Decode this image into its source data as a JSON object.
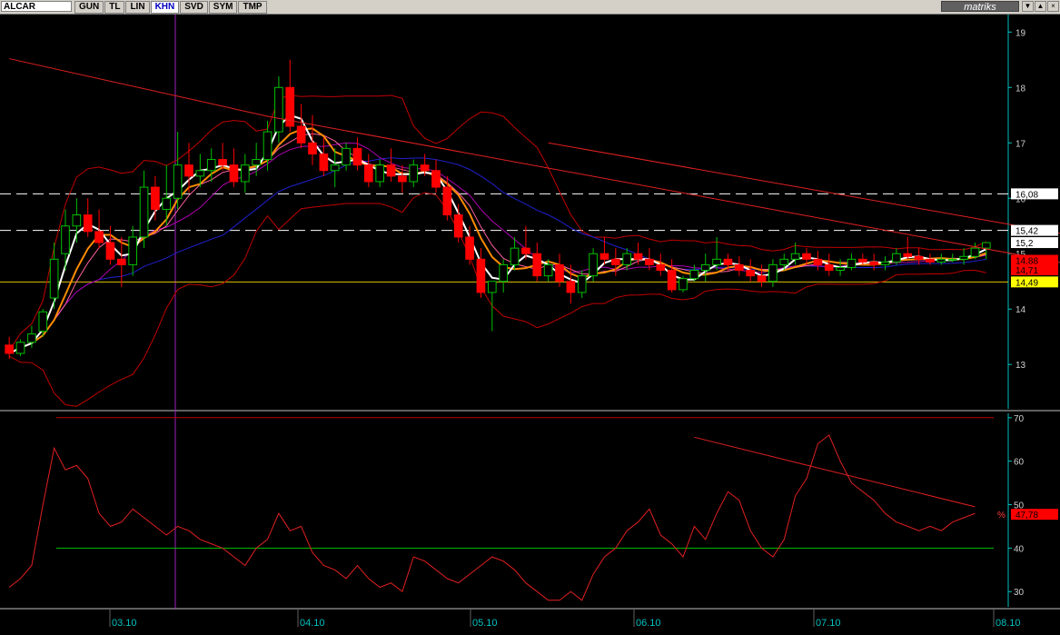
{
  "toolbar": {
    "symbol": "ALCAR",
    "tabs": [
      "GUN",
      "TL",
      "LIN",
      "KHN",
      "SVD",
      "SYM",
      "TMP"
    ],
    "active_tab": "KHN",
    "logo": "matriks",
    "buttons": [
      "▼",
      "▲",
      "×"
    ]
  },
  "x_axis": {
    "labels": [
      "03.10",
      "04.10",
      "05.10",
      "06.10",
      "07.10",
      "08.10"
    ]
  },
  "colors": {
    "up": "#00c000",
    "down": "#ff0000",
    "bollinger": "#c00000",
    "rsi": "#e02020",
    "ma_white": "#ffffff",
    "ma_orange": "#ff8c00",
    "ma_blue": "#2020d0",
    "ma_purple": "#b000b0",
    "ma_pink": "#ff60a0",
    "axis": "#00c0c0"
  },
  "chart_data": [
    {
      "type": "candlestick",
      "ylim": [
        12.2,
        19.3
      ],
      "yticks": [
        13,
        14,
        15,
        16,
        17,
        18,
        19
      ],
      "price_labels": [
        {
          "value": 16.08,
          "text": "16,08",
          "bg": "#ffffff",
          "fg": "#000000"
        },
        {
          "value": 15.42,
          "text": "15,42",
          "bg": "#ffffff",
          "fg": "#000000"
        },
        {
          "value": 15.2,
          "text": "15,2",
          "bg": "#ffffff",
          "fg": "#000000"
        },
        {
          "value": 14.88,
          "text": "14,88",
          "bg": "#ff0000",
          "fg": "#000000"
        },
        {
          "value": 14.71,
          "text": "14,71",
          "bg": "#ff0000",
          "fg": "#000000"
        },
        {
          "value": 14.49,
          "text": "14,49",
          "bg": "#ffff00",
          "fg": "#000000"
        }
      ],
      "horizontal_lines": [
        {
          "value": 16.08,
          "style": "dashed"
        },
        {
          "value": 15.42,
          "style": "dashed"
        },
        {
          "value": 14.49,
          "style": "solid-yellow"
        }
      ],
      "trendlines": [
        [
          {
            "i": 0,
            "v": 18.52
          },
          {
            "i": 23,
            "v": 17.48
          }
        ],
        [
          {
            "i": 23,
            "v": 17.48
          },
          {
            "i": 96,
            "v": 14.75
          }
        ],
        [
          {
            "i": 48,
            "v": 17.0
          },
          {
            "i": 96,
            "v": 15.28
          }
        ]
      ],
      "ohlc": [
        [
          13.35,
          13.5,
          13.1,
          13.2
        ],
        [
          13.2,
          13.45,
          13.15,
          13.4
        ],
        [
          13.4,
          13.7,
          13.3,
          13.55
        ],
        [
          13.6,
          14.0,
          13.5,
          13.95
        ],
        [
          14.2,
          15.2,
          14.0,
          14.9
        ],
        [
          15.0,
          15.8,
          14.7,
          15.5
        ],
        [
          15.5,
          16.0,
          15.2,
          15.7
        ],
        [
          15.7,
          16.0,
          15.3,
          15.4
        ],
        [
          15.4,
          15.8,
          15.1,
          15.2
        ],
        [
          15.2,
          15.5,
          14.8,
          14.9
        ],
        [
          14.9,
          15.3,
          14.4,
          14.8
        ],
        [
          14.8,
          15.5,
          14.6,
          15.3
        ],
        [
          15.3,
          16.5,
          15.1,
          16.2
        ],
        [
          16.2,
          16.4,
          15.6,
          15.8
        ],
        [
          15.8,
          16.6,
          15.5,
          16.0
        ],
        [
          16.0,
          17.2,
          15.8,
          16.6
        ],
        [
          16.6,
          17.0,
          16.1,
          16.4
        ],
        [
          16.4,
          16.8,
          16.2,
          16.5
        ],
        [
          16.5,
          16.9,
          16.3,
          16.7
        ],
        [
          16.7,
          17.0,
          16.5,
          16.6
        ],
        [
          16.6,
          16.9,
          16.2,
          16.3
        ],
        [
          16.3,
          16.8,
          16.1,
          16.6
        ],
        [
          16.6,
          17.0,
          16.4,
          16.7
        ],
        [
          16.7,
          17.4,
          16.5,
          17.2
        ],
        [
          17.2,
          18.2,
          17.0,
          18.0
        ],
        [
          18.0,
          18.5,
          17.2,
          17.3
        ],
        [
          17.3,
          17.7,
          16.9,
          17.0
        ],
        [
          17.0,
          17.5,
          16.6,
          16.8
        ],
        [
          16.8,
          17.1,
          16.4,
          16.5
        ],
        [
          16.5,
          16.9,
          16.2,
          16.6
        ],
        [
          16.6,
          17.0,
          16.5,
          16.9
        ],
        [
          16.9,
          17.1,
          16.5,
          16.6
        ],
        [
          16.6,
          16.8,
          16.2,
          16.3
        ],
        [
          16.3,
          16.7,
          16.2,
          16.6
        ],
        [
          16.6,
          16.9,
          16.3,
          16.4
        ],
        [
          16.4,
          16.6,
          16.1,
          16.3
        ],
        [
          16.3,
          16.7,
          16.2,
          16.6
        ],
        [
          16.6,
          16.8,
          16.4,
          16.5
        ],
        [
          16.5,
          16.7,
          16.1,
          16.2
        ],
        [
          16.2,
          16.4,
          15.6,
          15.7
        ],
        [
          15.7,
          15.9,
          15.2,
          15.3
        ],
        [
          15.3,
          15.5,
          14.8,
          14.9
        ],
        [
          14.9,
          15.1,
          14.2,
          14.3
        ],
        [
          14.3,
          14.5,
          13.6,
          14.5
        ],
        [
          14.5,
          14.9,
          14.3,
          14.8
        ],
        [
          14.8,
          15.3,
          14.7,
          15.1
        ],
        [
          15.1,
          15.5,
          14.9,
          15.0
        ],
        [
          15.0,
          15.2,
          14.5,
          14.6
        ],
        [
          14.6,
          14.9,
          14.5,
          14.8
        ],
        [
          14.8,
          15.0,
          14.4,
          14.5
        ],
        [
          14.5,
          14.8,
          14.1,
          14.3
        ],
        [
          14.3,
          14.7,
          14.2,
          14.6
        ],
        [
          14.6,
          15.1,
          14.5,
          15.0
        ],
        [
          15.0,
          15.3,
          14.8,
          14.9
        ],
        [
          14.9,
          15.1,
          14.6,
          14.8
        ],
        [
          14.8,
          15.1,
          14.7,
          15.0
        ],
        [
          15.0,
          15.2,
          14.8,
          14.9
        ],
        [
          14.9,
          15.1,
          14.7,
          14.8
        ],
        [
          14.8,
          15.0,
          14.6,
          14.7
        ],
        [
          14.7,
          14.9,
          14.3,
          14.35
        ],
        [
          14.35,
          14.6,
          14.3,
          14.55
        ],
        [
          14.55,
          14.8,
          14.5,
          14.7
        ],
        [
          14.7,
          15.0,
          14.5,
          14.8
        ],
        [
          14.8,
          15.3,
          14.7,
          14.9
        ],
        [
          14.9,
          15.0,
          14.7,
          14.8
        ],
        [
          14.8,
          14.95,
          14.6,
          14.7
        ],
        [
          14.7,
          14.9,
          14.5,
          14.6
        ],
        [
          14.6,
          14.8,
          14.4,
          14.5
        ],
        [
          14.5,
          14.9,
          14.4,
          14.8
        ],
        [
          14.8,
          15.0,
          14.7,
          14.9
        ],
        [
          14.9,
          15.2,
          14.8,
          15.0
        ],
        [
          15.0,
          15.1,
          14.8,
          14.9
        ],
        [
          14.9,
          15.05,
          14.7,
          14.8
        ],
        [
          14.8,
          15.0,
          14.6,
          14.7
        ],
        [
          14.7,
          14.9,
          14.6,
          14.75
        ],
        [
          14.75,
          15.0,
          14.7,
          14.9
        ],
        [
          14.9,
          15.0,
          14.8,
          14.85
        ],
        [
          14.85,
          15.0,
          14.7,
          14.8
        ],
        [
          14.8,
          14.95,
          14.7,
          14.85
        ],
        [
          14.85,
          15.1,
          14.8,
          15.0
        ],
        [
          15.0,
          15.3,
          14.9,
          14.95
        ],
        [
          14.95,
          15.1,
          14.8,
          14.9
        ],
        [
          14.9,
          15.0,
          14.8,
          14.85
        ],
        [
          14.85,
          15.0,
          14.8,
          14.9
        ],
        [
          14.9,
          15.0,
          14.85,
          14.9
        ],
        [
          14.9,
          15.1,
          14.8,
          14.95
        ],
        [
          14.95,
          15.2,
          14.9,
          15.1
        ],
        [
          15.1,
          15.2,
          14.9,
          15.2
        ]
      ]
    },
    {
      "type": "line",
      "ylim": [
        26.5,
        71
      ],
      "yticks": [
        30,
        40,
        50,
        60,
        70
      ],
      "value_label": {
        "value": 47.78,
        "text": "47,78",
        "unit": "%"
      },
      "horizontal_lines": [
        {
          "value": 70,
          "color": "#c00000"
        },
        {
          "value": 40,
          "color": "#00c000"
        }
      ],
      "trendlines": [
        [
          {
            "i": 61,
            "v": 65.5
          },
          {
            "i": 86,
            "v": 49.5
          }
        ]
      ],
      "values": [
        31,
        33,
        36,
        50,
        63,
        58,
        59,
        56,
        48,
        45,
        46,
        49,
        47,
        45,
        43,
        45,
        44,
        42,
        41,
        40,
        38,
        36,
        40,
        42,
        48,
        44,
        45,
        39,
        36,
        35,
        33,
        36,
        33,
        31,
        32,
        30,
        38,
        37,
        35,
        33,
        32,
        34,
        36,
        38,
        37,
        35,
        32,
        30,
        28,
        28,
        30,
        28,
        34,
        38,
        40,
        44,
        46,
        49,
        43,
        41,
        38,
        45,
        42,
        48,
        53,
        51,
        44,
        40,
        38,
        42,
        52,
        56,
        64,
        66,
        60,
        55,
        53,
        51,
        48,
        46,
        45,
        44,
        45,
        44,
        46,
        47,
        48
      ]
    }
  ]
}
